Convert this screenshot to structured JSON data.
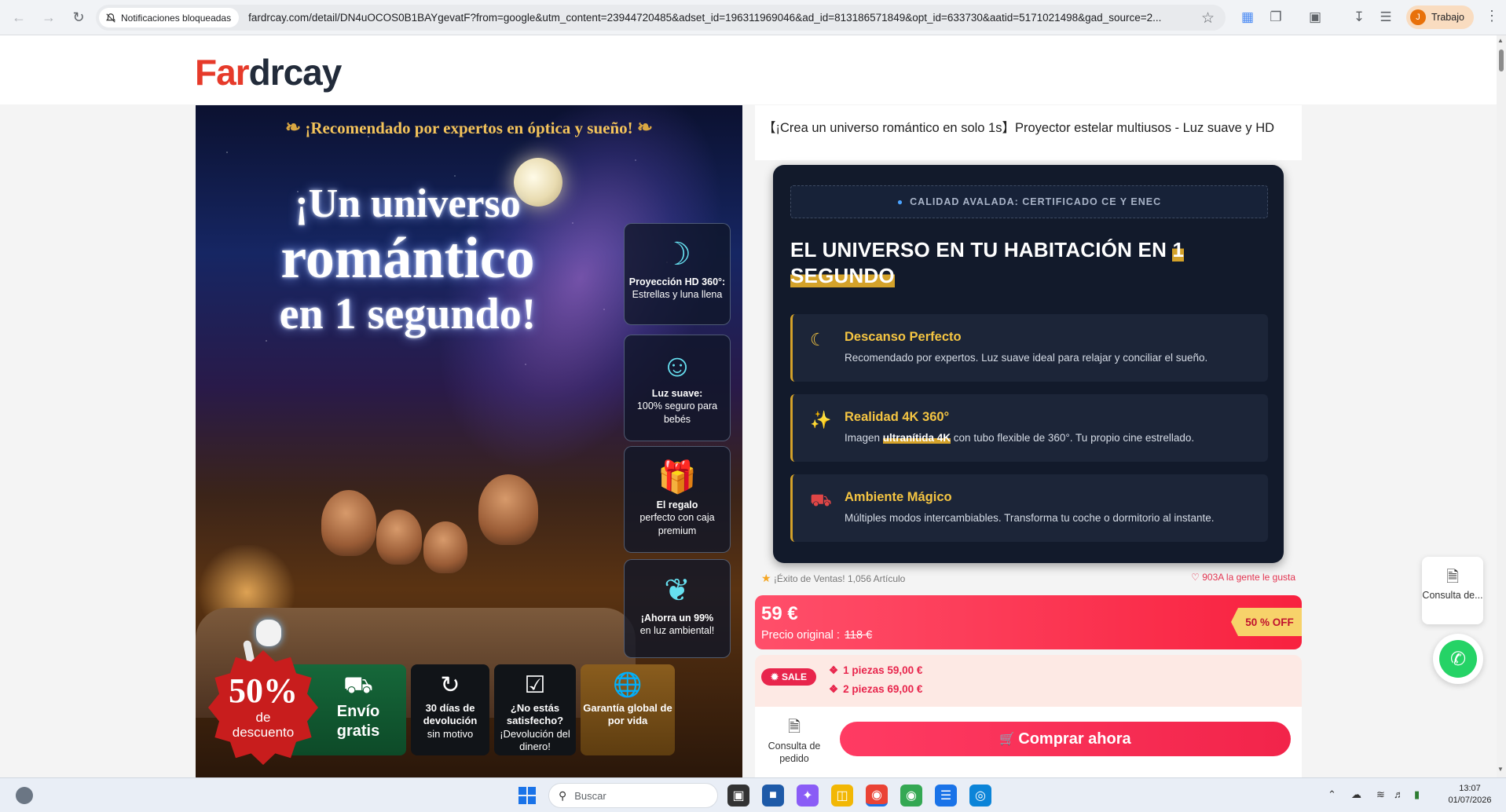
{
  "browser": {
    "blocked_chip": "Notificaciones bloqueadas",
    "url": "fardrcay.com/detail/DN4uOCOS0B1BAYgevatF?from=google&utm_content=23944720485&adset_id=196311969046&ad_id=813186571849&opt_id=633730&aatid=5171021498&gad_source=2...",
    "profile_initial": "J",
    "profile_label": "Trabajo"
  },
  "site": {
    "logo_accent": "Far",
    "logo_rest": "drcay"
  },
  "hero": {
    "top_banner": "¡Recomendado por expertos en óptica y sueño!",
    "title_line1": "¡Un universo",
    "title_line2": "romántico",
    "title_line3": "en 1 segundo!",
    "side_cards": [
      {
        "icon": "moon-360-icon",
        "bold": "Proyección HD 360°:",
        "text": "Estrellas y luna llena"
      },
      {
        "icon": "baby-icon",
        "bold": "Luz suave:",
        "text": "100% seguro para bebés"
      },
      {
        "icon": "gift-icon",
        "bold": "El regalo",
        "text": "perfecto con caja premium"
      },
      {
        "icon": "leaf-icon",
        "bold": "¡Ahorra un 99%",
        "text": "en luz ambiental!"
      }
    ],
    "badges": {
      "discount_pct": "50%",
      "discount_de": "de",
      "discount_word": "descuento",
      "shipping_line1": "Envío",
      "shipping_line2": "gratis",
      "returns_bold": "30 días de devolución",
      "returns_text": "sin motivo",
      "satisfied_bold": "¿No estás satisfecho?",
      "satisfied_text": "¡Devolución del dinero!",
      "warranty_bold": "Garantía global de por vida"
    }
  },
  "product": {
    "title": "【¡Crea un universo romántico en solo 1s】Proyector estelar multiusos - Luz suave y HD",
    "cert_label": "CALIDAD AVALADA: CERTIFICADO CE Y ENEC",
    "headline_main": "EL UNIVERSO EN TU HABITACIÓN EN ",
    "headline_hl": "1 SEGUNDO",
    "features": [
      {
        "icon": "moon-icon",
        "title": "Descanso Perfecto",
        "desc_pre": "Recomendado por expertos. Luz suave ideal para relajar y conciliar el sueño.",
        "desc_hl": "",
        "desc_post": ""
      },
      {
        "icon": "sparkles-icon",
        "title": "Realidad 4K 360°",
        "desc_pre": "Imagen ",
        "desc_hl": "ultranítida 4K",
        "desc_post": " con tubo flexible de 360°. Tu propio cine estrellado."
      },
      {
        "icon": "car-icon",
        "title": "Ambiente Mágico",
        "desc_pre": "Múltiples modos intercambiables. Transforma tu coche o dormitorio al instante.",
        "desc_hl": "",
        "desc_post": ""
      }
    ],
    "sales_text": "¡Éxito de Ventas! 1,056 Artículo",
    "likes_text": "903A la gente le gusta",
    "price": "59 €",
    "original_label": "Precio original :",
    "original_price": "118 €",
    "off_tag": "50 % OFF",
    "sale_badge": "SALE",
    "bundle_1": "1 piezas 59,00 €",
    "bundle_2": "2 piezas 69,00 €"
  },
  "buybar": {
    "consult_label": "Consulta de pedido",
    "buy_label": "Comprar ahora"
  },
  "floating": {
    "consult_label": "Consulta de..."
  },
  "taskbar": {
    "search_placeholder": "Buscar",
    "time": "13:07",
    "date": "01/07/2026"
  }
}
